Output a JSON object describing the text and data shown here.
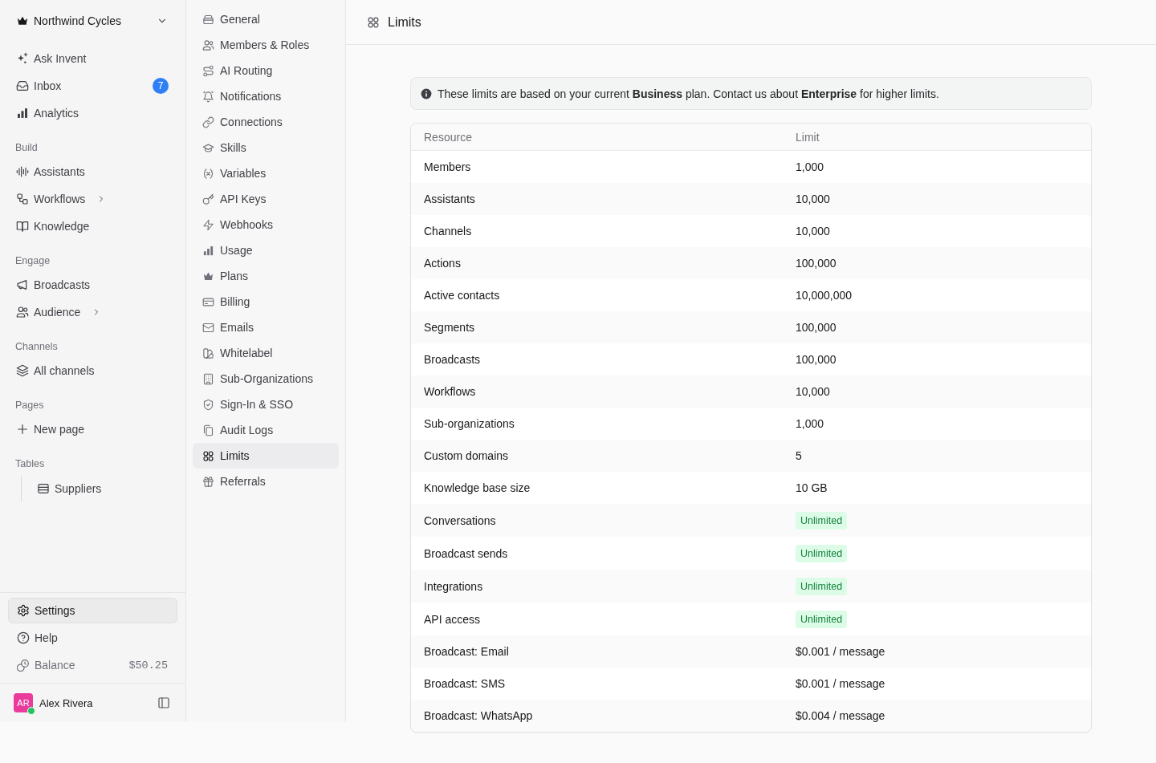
{
  "workspace": {
    "name": "Northwind Cycles"
  },
  "nav": {
    "sections": [
      {
        "kind": "list",
        "items": [
          {
            "label": "Ask Invent",
            "submenu": false
          },
          {
            "label": "Inbox",
            "badge": "7",
            "submenu": false
          },
          {
            "label": "Analytics",
            "submenu": false
          }
        ]
      },
      {
        "kind": "list",
        "label": "Build",
        "items": [
          {
            "label": "Assistants",
            "submenu": false
          },
          {
            "label": "Workflows",
            "submenu": true
          },
          {
            "label": "Knowledge",
            "submenu": false
          }
        ]
      },
      {
        "kind": "list",
        "label": "Engage",
        "items": [
          {
            "label": "Broadcasts",
            "submenu": false
          },
          {
            "label": "Audience",
            "submenu": true
          }
        ]
      },
      {
        "kind": "list",
        "label": "Channels",
        "items": [
          {
            "label": "All channels",
            "submenu": false
          }
        ]
      },
      {
        "kind": "list",
        "label": "Pages",
        "items": [
          {
            "label": "New page",
            "submenu": false
          }
        ]
      },
      {
        "kind": "tree",
        "label": "Tables",
        "items": [
          {
            "label": "Suppliers",
            "submenu": false
          }
        ]
      }
    ]
  },
  "footer": {
    "items": [
      {
        "kind": "link",
        "label": "Settings",
        "selected": true
      },
      {
        "kind": "link",
        "label": "Help",
        "selected": false
      },
      {
        "kind": "balance",
        "label": "Balance",
        "value": "$50.25",
        "selected": false
      }
    ]
  },
  "user": {
    "initials": "AR",
    "name": "Alex Rivera",
    "online": true
  },
  "settings_nav": {
    "items": [
      {
        "label": "General",
        "selected": false
      },
      {
        "label": "Members & Roles",
        "selected": false
      },
      {
        "label": "AI Routing",
        "selected": false
      },
      {
        "label": "Notifications",
        "selected": false
      },
      {
        "label": "Connections",
        "selected": false
      },
      {
        "label": "Skills",
        "selected": false
      },
      {
        "label": "Variables",
        "selected": false
      },
      {
        "label": "API Keys",
        "selected": false
      },
      {
        "label": "Webhooks",
        "selected": false
      },
      {
        "label": "Usage",
        "selected": false
      },
      {
        "label": "Plans",
        "selected": false
      },
      {
        "label": "Billing",
        "selected": false
      },
      {
        "label": "Emails",
        "selected": false
      },
      {
        "label": "Whitelabel",
        "selected": false
      },
      {
        "label": "Sub-Organizations",
        "selected": false
      },
      {
        "label": "Sign-In & SSO",
        "selected": false
      },
      {
        "label": "Audit Logs",
        "selected": false
      },
      {
        "label": "Limits",
        "selected": true
      },
      {
        "label": "Referrals",
        "selected": false
      }
    ]
  },
  "header": {
    "title": "Limits"
  },
  "notice": {
    "text": "These limits are based on your current **Business** plan. Contact us about **Enterprise** for higher limits."
  },
  "table": {
    "columns": [
      "Resource",
      "Limit"
    ],
    "rows": [
      {
        "resource": "Members",
        "limit": "1,000",
        "kind": "text"
      },
      {
        "resource": "Assistants",
        "limit": "10,000",
        "kind": "text"
      },
      {
        "resource": "Channels",
        "limit": "10,000",
        "kind": "text"
      },
      {
        "resource": "Actions",
        "limit": "100,000",
        "kind": "text"
      },
      {
        "resource": "Active contacts",
        "limit": "10,000,000",
        "kind": "text"
      },
      {
        "resource": "Segments",
        "limit": "100,000",
        "kind": "text"
      },
      {
        "resource": "Broadcasts",
        "limit": "100,000",
        "kind": "text"
      },
      {
        "resource": "Workflows",
        "limit": "10,000",
        "kind": "text"
      },
      {
        "resource": "Sub-organizations",
        "limit": "1,000",
        "kind": "text"
      },
      {
        "resource": "Custom domains",
        "limit": "5",
        "kind": "text"
      },
      {
        "resource": "Knowledge base size",
        "limit": "10 GB",
        "kind": "text"
      },
      {
        "resource": "Conversations",
        "limit": "Unlimited",
        "kind": "badge"
      },
      {
        "resource": "Broadcast sends",
        "limit": "Unlimited",
        "kind": "badge"
      },
      {
        "resource": "Integrations",
        "limit": "Unlimited",
        "kind": "badge"
      },
      {
        "resource": "API access",
        "limit": "Unlimited",
        "kind": "badge"
      },
      {
        "resource": "Broadcast: Email",
        "limit": "$0.001 / message",
        "kind": "text"
      },
      {
        "resource": "Broadcast: SMS",
        "limit": "$0.001 / message",
        "kind": "text"
      },
      {
        "resource": "Broadcast: WhatsApp",
        "limit": "$0.004 / message",
        "kind": "text"
      }
    ]
  }
}
